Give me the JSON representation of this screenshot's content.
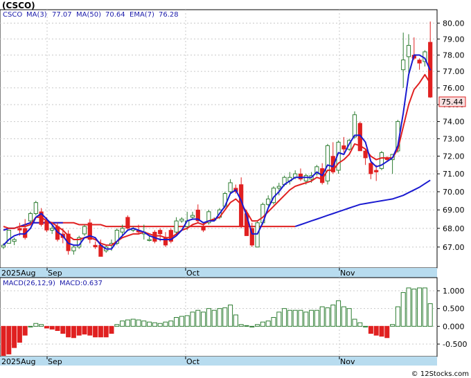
{
  "ticker_title": "(CSCO)",
  "watermark": "© 12Stocks.com",
  "price_panel": {
    "legend": {
      "symbol": "CSCO",
      "ma3": "MA(3)",
      "ma3_value": "77.07",
      "ma50": "MA(50)",
      "ma50_value": "70.64",
      "ema7": "EMA(7)",
      "ema7_value": "76.28"
    },
    "last_price_label": "75.44",
    "y_tick_labels": [
      "80.00",
      "79.00",
      "78.00",
      "77.00",
      "76.00",
      "75.00",
      "74.00",
      "73.00",
      "72.00",
      "71.00",
      "70.00",
      "69.00",
      "68.00",
      "67.00"
    ],
    "x_tick_labels": [
      "2025Aug",
      "Sep",
      "Oct",
      "Nov"
    ]
  },
  "macd_panel": {
    "legend": "MACD(26,12,9)",
    "legend_value": "MACD:0.637",
    "y_tick_labels": [
      "1.000",
      "0.500",
      "0.000",
      "-0.500"
    ],
    "x_tick_labels": [
      "2025Aug",
      "Sep",
      "Oct",
      "Nov"
    ]
  },
  "colors": {
    "up_candle": "#2e7d32",
    "down_candle": "#e02020",
    "ma_fast": "#1a1ad0",
    "ema": "#e02020",
    "axis_band": "#b8dcef",
    "macd_bar": "#2e7d32",
    "macd_neg": "#e02020"
  },
  "chart_data": [
    {
      "type": "candlestick",
      "title": "(CSCO)",
      "price_axis_scale": "log",
      "ylim": [
        66.3,
        80.5
      ],
      "x_axis_labels": [
        "2025Aug",
        "Sep",
        "Oct",
        "Nov"
      ],
      "series": [
        {
          "name": "Price",
          "ohlc": [
            [
              67.0,
              67.2,
              66.9,
              67.1
            ],
            [
              67.2,
              67.9,
              67.2,
              67.9
            ],
            [
              67.3,
              67.5,
              67.1,
              67.4
            ],
            [
              68.0,
              68.3,
              67.6,
              67.9
            ],
            [
              68.0,
              68.5,
              67.4,
              67.5
            ],
            [
              68.4,
              68.9,
              68.3,
              68.8
            ],
            [
              68.8,
              69.5,
              68.7,
              69.4
            ],
            [
              68.9,
              69.1,
              68.1,
              68.2
            ],
            [
              68.4,
              68.6,
              67.8,
              67.9
            ],
            [
              67.9,
              68.2,
              67.7,
              68.0
            ],
            [
              68.1,
              68.3,
              67.3,
              67.4
            ],
            [
              67.7,
              68.0,
              67.2,
              67.5
            ],
            [
              67.7,
              67.9,
              66.6,
              66.8
            ],
            [
              66.8,
              67.1,
              66.6,
              67.0
            ],
            [
              67.0,
              67.6,
              66.9,
              67.5
            ],
            [
              67.7,
              68.2,
              67.6,
              68.1
            ],
            [
              68.3,
              68.5,
              67.2,
              67.4
            ],
            [
              67.1,
              67.3,
              66.9,
              67.0
            ],
            [
              67.1,
              67.4,
              66.5,
              66.5
            ],
            [
              66.8,
              67.1,
              66.7,
              67.0
            ],
            [
              67.1,
              67.4,
              66.8,
              67.2
            ],
            [
              67.2,
              68.0,
              67.1,
              67.9
            ],
            [
              67.8,
              68.2,
              67.6,
              68.0
            ],
            [
              68.6,
              68.7,
              67.9,
              68.0
            ],
            [
              67.9,
              68.1,
              67.8,
              68.0
            ],
            [
              67.9,
              68.2,
              67.7,
              67.8
            ],
            [
              67.7,
              68.2,
              67.4,
              67.8
            ],
            [
              67.4,
              67.6,
              67.3,
              67.4
            ],
            [
              67.8,
              67.9,
              67.2,
              67.3
            ],
            [
              67.9,
              68.0,
              67.3,
              67.7
            ],
            [
              67.5,
              67.8,
              67.0,
              67.1
            ],
            [
              67.9,
              68.0,
              67.2,
              67.3
            ],
            [
              67.8,
              68.6,
              67.7,
              68.4
            ],
            [
              68.4,
              68.6,
              68.3,
              68.5
            ],
            [
              68.1,
              68.9,
              67.9,
              68.4
            ],
            [
              68.6,
              68.9,
              68.5,
              68.7
            ],
            [
              69.0,
              69.3,
              68.3,
              68.4
            ],
            [
              68.1,
              68.3,
              67.8,
              67.9
            ],
            [
              68.3,
              69.0,
              68.2,
              68.9
            ],
            [
              68.5,
              68.6,
              68.4,
              68.5
            ],
            [
              68.6,
              69.1,
              68.5,
              69.0
            ],
            [
              69.2,
              70.0,
              69.1,
              69.9
            ],
            [
              70.0,
              70.7,
              69.9,
              70.5
            ],
            [
              70.2,
              70.4,
              69.9,
              70.0
            ],
            [
              70.4,
              70.8,
              68.0,
              68.1
            ],
            [
              68.8,
              69.0,
              67.6,
              67.6
            ],
            [
              68.0,
              68.3,
              67.0,
              67.1
            ],
            [
              67.0,
              68.4,
              67.0,
              68.3
            ],
            [
              68.3,
              69.4,
              68.2,
              69.3
            ],
            [
              69.3,
              69.8,
              69.2,
              69.6
            ],
            [
              69.4,
              70.3,
              69.3,
              70.2
            ],
            [
              70.2,
              70.5,
              69.8,
              70.3
            ],
            [
              70.4,
              70.9,
              70.3,
              70.8
            ],
            [
              70.6,
              71.1,
              70.4,
              70.8
            ],
            [
              70.8,
              71.2,
              70.7,
              71.0
            ],
            [
              71.0,
              71.3,
              70.6,
              70.7
            ],
            [
              70.6,
              71.0,
              70.4,
              70.9
            ],
            [
              70.7,
              71.1,
              70.5,
              70.9
            ],
            [
              71.0,
              71.5,
              70.9,
              71.4
            ],
            [
              71.3,
              71.6,
              70.4,
              70.5
            ],
            [
              70.6,
              72.7,
              70.4,
              72.6
            ],
            [
              72.0,
              72.8,
              71.0,
              71.1
            ],
            [
              71.2,
              72.9,
              71.0,
              72.8
            ],
            [
              72.6,
              73.1,
              72.2,
              72.4
            ],
            [
              72.4,
              73.0,
              72.3,
              72.9
            ],
            [
              73.1,
              74.6,
              73.0,
              74.4
            ],
            [
              73.9,
              74.0,
              72.3,
              72.3
            ],
            [
              72.3,
              72.4,
              71.5,
              71.9
            ],
            [
              71.6,
              71.7,
              70.7,
              71.0
            ],
            [
              71.2,
              71.5,
              70.6,
              71.1
            ],
            [
              71.3,
              72.3,
              71.2,
              72.2
            ],
            [
              71.9,
              72.0,
              71.7,
              71.8
            ],
            [
              71.8,
              72.1,
              71.0,
              72.1
            ],
            [
              72.3,
              74.1,
              72.2,
              74.0
            ],
            [
              77.1,
              79.4,
              76.0,
              77.7
            ],
            [
              77.9,
              79.3,
              76.6,
              78.6
            ],
            [
              78.0,
              79.1,
              77.7,
              77.8
            ],
            [
              77.7,
              77.8,
              77.1,
              77.5
            ],
            [
              77.6,
              78.3,
              77.3,
              78.2
            ],
            [
              78.8,
              80.1,
              75.4,
              75.44
            ]
          ]
        },
        {
          "name": "MA(3)",
          "values": [
            67.1,
            67.4,
            67.6,
            67.7,
            67.7,
            68.0,
            68.6,
            68.8,
            68.5,
            68.2,
            67.8,
            67.6,
            67.2,
            67.1,
            67.1,
            67.5,
            67.6,
            67.5,
            67.1,
            66.9,
            66.9,
            67.3,
            67.6,
            67.9,
            68.0,
            67.9,
            67.8,
            67.6,
            67.5,
            67.4,
            67.4,
            67.4,
            67.6,
            67.9,
            68.4,
            68.5,
            68.5,
            68.3,
            68.4,
            68.4,
            68.8,
            69.2,
            69.9,
            70.1,
            69.5,
            68.7,
            67.7,
            67.7,
            68.3,
            69.1,
            69.7,
            70.0,
            70.4,
            70.6,
            70.8,
            70.8,
            70.8,
            70.8,
            71.1,
            70.9,
            71.5,
            71.4,
            72.2,
            72.1,
            72.7,
            73.2,
            73.2,
            72.8,
            71.7,
            71.4,
            71.5,
            71.7,
            71.9,
            72.6,
            74.5,
            76.8,
            78.0,
            78.0,
            77.8,
            77.07
          ]
        },
        {
          "name": "EMA(7)",
          "values": [
            68.1,
            68.0,
            68.0,
            68.1,
            68.1,
            68.2,
            68.6,
            68.6,
            68.4,
            68.3,
            68.1,
            67.9,
            67.6,
            67.4,
            67.4,
            67.5,
            67.5,
            67.4,
            67.2,
            67.1,
            67.1,
            67.3,
            67.5,
            67.6,
            67.7,
            67.7,
            67.8,
            67.7,
            67.6,
            67.6,
            67.5,
            67.5,
            67.7,
            67.9,
            68.0,
            68.2,
            68.3,
            68.2,
            68.4,
            68.5,
            68.6,
            69.0,
            69.4,
            69.6,
            69.3,
            68.9,
            68.4,
            68.4,
            68.6,
            68.9,
            69.2,
            69.5,
            69.8,
            70.1,
            70.3,
            70.4,
            70.5,
            70.6,
            70.8,
            70.7,
            71.2,
            71.2,
            71.6,
            71.8,
            72.1,
            72.7,
            72.6,
            72.4,
            72.0,
            71.8,
            71.9,
            71.9,
            71.9,
            72.4,
            73.7,
            75.0,
            75.9,
            76.3,
            76.8,
            76.28
          ]
        },
        {
          "name": "MA(50)",
          "values": [
            67.9,
            68.0,
            68.0,
            68.1,
            68.2,
            68.3,
            68.3,
            68.3,
            68.3,
            68.3,
            68.3,
            68.3,
            68.3,
            68.3,
            68.2,
            68.2,
            68.2,
            68.2,
            68.2,
            68.1,
            68.1,
            68.1,
            68.1,
            68.1,
            68.1,
            68.1,
            68.1,
            68.1,
            68.1,
            68.1,
            68.1,
            68.1,
            68.1,
            68.1,
            68.1,
            68.1,
            68.1,
            68.1,
            68.1,
            68.1,
            68.1,
            68.1,
            68.1,
            68.1,
            68.1,
            68.1,
            68.1,
            68.1,
            68.1,
            68.1,
            68.1,
            68.1,
            68.1,
            68.1,
            68.1,
            68.2,
            68.3,
            68.4,
            68.5,
            68.6,
            68.7,
            68.8,
            68.9,
            69.0,
            69.1,
            69.2,
            69.3,
            69.35,
            69.4,
            69.45,
            69.5,
            69.55,
            69.6,
            69.7,
            69.8,
            69.95,
            70.1,
            70.25,
            70.45,
            70.64
          ]
        }
      ]
    },
    {
      "type": "bar",
      "title": "MACD(26,12,9)",
      "ylim": [
        -0.9,
        1.25
      ],
      "x_axis_labels": [
        "2025Aug",
        "Sep",
        "Oct",
        "Nov"
      ],
      "series": [
        {
          "name": "MACD",
          "values": [
            -0.82,
            -0.78,
            -0.6,
            -0.45,
            -0.25,
            0.0,
            0.08,
            0.05,
            -0.05,
            -0.08,
            -0.12,
            -0.2,
            -0.3,
            -0.32,
            -0.25,
            -0.22,
            -0.25,
            -0.3,
            -0.3,
            -0.3,
            -0.2,
            0.05,
            0.15,
            0.18,
            0.2,
            0.18,
            0.15,
            0.12,
            0.1,
            0.08,
            0.12,
            0.15,
            0.25,
            0.28,
            0.3,
            0.4,
            0.45,
            0.4,
            0.5,
            0.45,
            0.5,
            0.52,
            0.6,
            0.32,
            0.05,
            0.02,
            0.0,
            0.05,
            0.12,
            0.15,
            0.25,
            0.4,
            0.5,
            0.45,
            0.45,
            0.45,
            0.4,
            0.45,
            0.45,
            0.55,
            0.52,
            0.6,
            0.72,
            0.55,
            0.5,
            0.2,
            0.1,
            0.0,
            -0.2,
            -0.25,
            -0.28,
            -0.32,
            0.05,
            0.55,
            0.95,
            1.08,
            1.05,
            1.08,
            1.08,
            0.637
          ]
        }
      ]
    }
  ]
}
